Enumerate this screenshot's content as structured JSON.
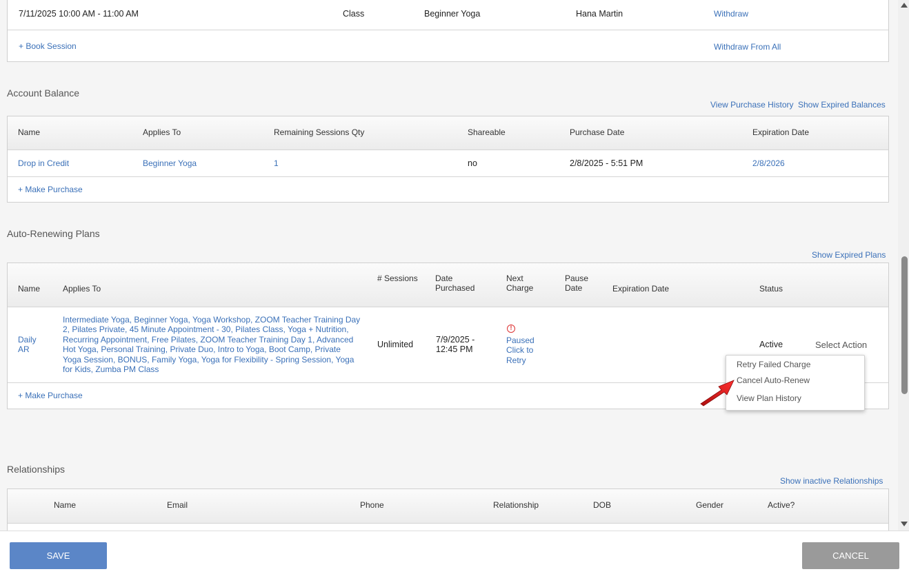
{
  "sessions": {
    "row": {
      "datetime": "7/11/2025 10:00 AM - 11:00 AM",
      "type": "Class",
      "name": "Beginner Yoga",
      "instructor": "Hana Martin",
      "action": "Withdraw"
    },
    "book_link": "+ Book Session",
    "withdraw_all_link": "Withdraw From All"
  },
  "account_balance": {
    "title": "Account Balance",
    "links": [
      "View Purchase History",
      "Show Expired Balances"
    ],
    "headers": [
      "Name",
      "Applies To",
      "Remaining Sessions Qty",
      "Shareable",
      "Purchase Date",
      "Expiration Date"
    ],
    "row": {
      "name": "Drop in Credit",
      "applies_to": "Beginner Yoga",
      "remaining": "1",
      "shareable": "no",
      "purchase_date": "2/8/2025 - 5:51 PM",
      "expiration_date": "2/8/2026"
    },
    "make_purchase": "+ Make Purchase"
  },
  "auto_renewing": {
    "title": "Auto-Renewing Plans",
    "show_expired": "Show Expired Plans",
    "headers": {
      "name": "Name",
      "applies_to": "Applies To",
      "sessions": "# Sessions",
      "date_purchased": "Date Purchased",
      "next_charge": "Next Charge",
      "pause_date": "Pause Date",
      "expiration_date": "Expiration Date",
      "status": "Status"
    },
    "row": {
      "name": "Daily AR",
      "applies_to": "Intermediate Yoga, Beginner Yoga, Yoga Workshop, ZOOM Teacher Training Day 2, Pilates Private, 45 Minute Appointment - 30, Pilates Class, Yoga + Nutrition, Recurring Appointment, Free Pilates, ZOOM Teacher Training Day 1, Advanced Hot Yoga, Personal Training, Private Duo, Intro to Yoga, Boot Camp, Private Yoga Session, BONUS, Family Yoga, Yoga for Flexibility - Spring Session, Yoga for Kids, Zumba PM Class",
      "sessions": "Unlimited",
      "date_purchased": "7/9/2025 - 12:45 PM",
      "next_charge_icon": "alert-circle-icon",
      "next_charge": "Paused Click to Retry",
      "status": "Active",
      "select_action": "Select Action"
    },
    "make_purchase": "+ Make Purchase",
    "dropdown": [
      "Retry Failed Charge",
      "Cancel Auto-Renew",
      "View Plan History"
    ]
  },
  "relationships": {
    "title": "Relationships",
    "show_inactive": "Show inactive Relationships",
    "headers": [
      "Name",
      "Email",
      "Phone",
      "Relationship",
      "DOB",
      "Gender",
      "Active?"
    ]
  },
  "footer": {
    "save": "SAVE",
    "cancel": "CANCEL"
  },
  "colors": {
    "link": "#3a70b8",
    "save_button": "#5b86c7",
    "cancel_button": "#9a9a9a",
    "alert": "#dd3333",
    "arrow": "#e02020"
  }
}
